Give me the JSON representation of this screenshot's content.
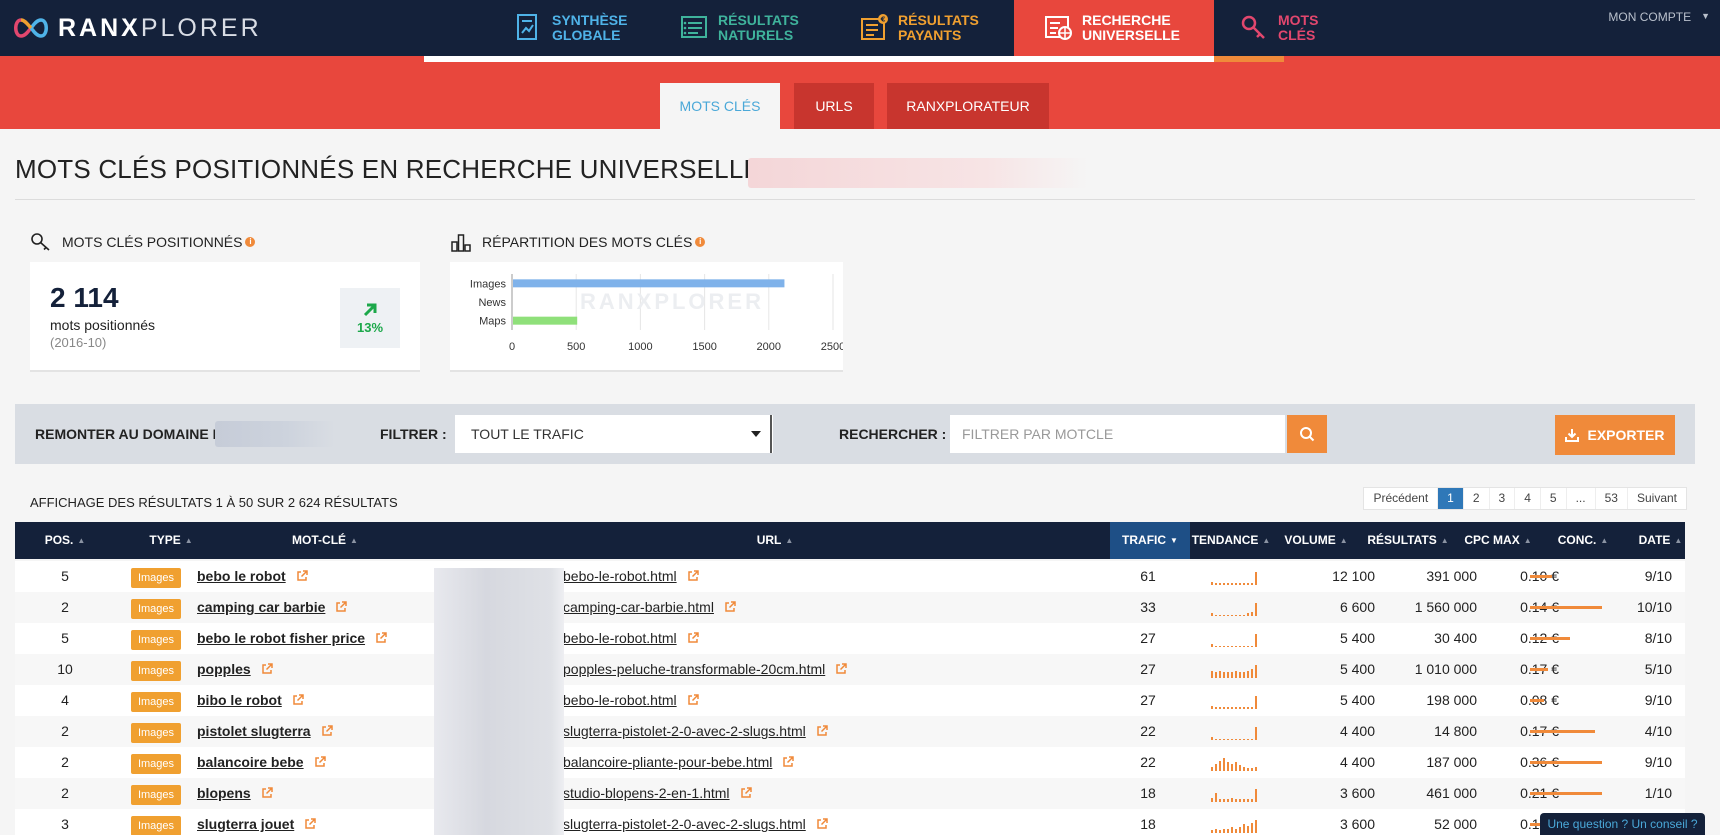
{
  "brand": {
    "name_bold": "RANX",
    "name_thin": "PLORER"
  },
  "nav": {
    "synthese": "SYNTHÈSE GLOBALE",
    "naturels": "RÉSULTATS NATURELS",
    "payants": "RÉSULTATS PAYANTS",
    "universelle": "RECHERCHE UNIVERSELLE",
    "mots": "MOTS CLÉS",
    "account": "MON COMPTE"
  },
  "subtabs": {
    "mots": "MOTS CLÉS",
    "urls": "URLS",
    "ranx": "RANXPLORATEUR"
  },
  "page_title": "MOTS CLÉS POSITIONNÉS EN RECHERCHE UNIVERSELLE >",
  "widgets": {
    "keywords": {
      "title": "MOTS CLÉS POSITIONNÉS",
      "count": "2 114",
      "label": "mots positionnés",
      "date": "(2016-10)",
      "trend": "13%"
    },
    "repartition": {
      "title": "RÉPARTITION DES MOTS CLÉS"
    }
  },
  "chart_data": {
    "type": "bar",
    "orientation": "horizontal",
    "categories": [
      "Images",
      "News",
      "Maps"
    ],
    "values": [
      2114,
      0,
      500
    ],
    "colors": [
      "#7fb2ea",
      "#7fb2ea",
      "#8fe07a"
    ],
    "xticks": [
      "0",
      "500",
      "1000",
      "1500",
      "2000",
      "2500"
    ],
    "xlim": [
      0,
      2500
    ],
    "watermark": "RANXPLORER"
  },
  "filters": {
    "up_label": "REMONTER AU DOMAINE",
    "up_prefix": "M",
    "filter_label": "FILTRER :",
    "filter_value": "TOUT LE TRAFIC",
    "search_label": "RECHERCHER :",
    "search_placeholder": "FILTRER PAR MOTCLE",
    "export": "EXPORTER"
  },
  "results": {
    "summary": "AFFICHAGE DES RÉSULTATS 1 À 50 SUR 2 624 RÉSULTATS",
    "pager": {
      "prev": "Précédent",
      "pages": [
        "1",
        "2",
        "3",
        "4",
        "5",
        "...",
        "53"
      ],
      "next": "Suivant",
      "current": "1"
    }
  },
  "table": {
    "columns": {
      "pos": "POS.",
      "type": "TYPE",
      "kw": "MOT-CLÉ",
      "url": "URL",
      "traf": "TRAFIC",
      "tend": "TENDANCE",
      "vol": "VOLUME",
      "res": "RÉSULTATS",
      "cpc": "CPC MAX",
      "conc": "CONC.",
      "date": "DATE"
    },
    "rows": [
      {
        "pos": "5",
        "type": "Images",
        "kw": "bebo le robot",
        "url": "bebo-le-robot.html",
        "traf": "61",
        "vol": "12 100",
        "res": "391 000",
        "cpc": "0.10 €",
        "conc": 0.3,
        "date": "9/10",
        "trend": [
          2,
          1,
          1,
          1,
          1,
          1,
          1,
          1,
          1,
          1,
          1,
          8
        ]
      },
      {
        "pos": "2",
        "type": "Images",
        "kw": "camping car barbie",
        "url": "camping-car-barbie.html",
        "traf": "33",
        "vol": "6 600",
        "res": "1 560 000",
        "cpc": "0.14 €",
        "conc": 1.0,
        "date": "10/10",
        "trend": [
          2,
          1,
          1,
          1,
          1,
          1,
          1,
          1,
          1,
          2,
          3,
          9
        ]
      },
      {
        "pos": "5",
        "type": "Images",
        "kw": "bebo le robot fisher price",
        "url": "bebo-le-robot.html",
        "traf": "27",
        "vol": "5 400",
        "res": "30 400",
        "cpc": "0.12 €",
        "conc": 0.55,
        "date": "8/10",
        "trend": [
          2,
          1,
          1,
          1,
          1,
          1,
          1,
          1,
          1,
          1,
          1,
          9
        ]
      },
      {
        "pos": "10",
        "type": "Images",
        "kw": "popples",
        "url": "popples-peluche-transformable-20cm.html",
        "traf": "27",
        "vol": "5 400",
        "res": "1 010 000",
        "cpc": "0.17 €",
        "conc": 0.25,
        "date": "5/10",
        "trend": [
          5,
          4,
          5,
          4,
          4,
          4,
          5,
          4,
          4,
          5,
          6,
          9
        ]
      },
      {
        "pos": "4",
        "type": "Images",
        "kw": "bibo le robot",
        "url": "bebo-le-robot.html",
        "traf": "27",
        "vol": "5 400",
        "res": "198 000",
        "cpc": "0.08 €",
        "conc": 0.2,
        "date": "9/10",
        "trend": [
          2,
          1,
          1,
          1,
          1,
          1,
          1,
          1,
          1,
          1,
          1,
          8
        ]
      },
      {
        "pos": "2",
        "type": "Images",
        "kw": "pistolet slugterra",
        "url": "slugterra-pistolet-2-0-avec-2-slugs.html",
        "traf": "22",
        "vol": "4 400",
        "res": "14 800",
        "cpc": "0.17 €",
        "conc": 0.9,
        "date": "4/10",
        "trend": [
          2,
          1,
          1,
          1,
          1,
          1,
          1,
          1,
          1,
          1,
          1,
          9
        ]
      },
      {
        "pos": "2",
        "type": "Images",
        "kw": "balancoire bebe",
        "url": "balancoire-pliante-pour-bebe.html",
        "traf": "22",
        "vol": "4 400",
        "res": "187 000",
        "cpc": "0.36 €",
        "conc": 1.0,
        "date": "9/10",
        "trend": [
          3,
          5,
          7,
          9,
          6,
          5,
          6,
          4,
          3,
          2,
          2,
          3
        ]
      },
      {
        "pos": "2",
        "type": "Images",
        "kw": "blopens",
        "url": "studio-blopens-2-en-1.html",
        "traf": "18",
        "vol": "3 600",
        "res": "461 000",
        "cpc": "0.21 €",
        "conc": 1.0,
        "date": "1/10",
        "trend": [
          3,
          6,
          2,
          2,
          2,
          3,
          2,
          2,
          2,
          2,
          2,
          9
        ]
      },
      {
        "pos": "3",
        "type": "Images",
        "kw": "slugterra jouet",
        "url": "slugterra-pistolet-2-0-avec-2-slugs.html",
        "traf": "18",
        "vol": "3 600",
        "res": "52 000",
        "cpc": "0.18 €",
        "conc": 0.9,
        "date": "4/10",
        "trend": [
          2,
          3,
          2,
          3,
          3,
          4,
          3,
          4,
          6,
          5,
          7,
          9
        ]
      }
    ]
  },
  "help": "Une question ? Un conseil ?"
}
